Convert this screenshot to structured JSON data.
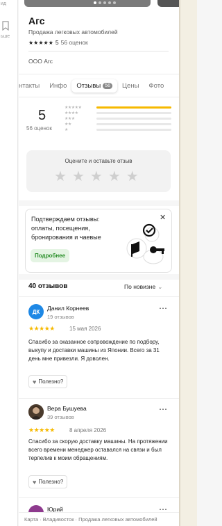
{
  "rail": {
    "top_text": "ид",
    "bottom_text": "ьше",
    "icon": "bookmark-icon"
  },
  "org": {
    "title": "Агс",
    "category": "Продажа легковых автомобилей",
    "rating_value": "5",
    "reviews_count_label": "56 оценок",
    "legal_name": "ООО Агс"
  },
  "tabs": [
    {
      "label": "нтакты"
    },
    {
      "label": "Инфо"
    },
    {
      "label": "Отзывы",
      "badge": "56"
    },
    {
      "label": "Цены"
    },
    {
      "label": "Фото"
    }
  ],
  "summary": {
    "rating": "5",
    "count_label": "56 оценок",
    "distribution": [
      {
        "stars": "★★★★★",
        "fraction": 1.0
      },
      {
        "stars": "★★★★",
        "fraction": 0
      },
      {
        "stars": "★★★",
        "fraction": 0
      },
      {
        "stars": "★★",
        "fraction": 0
      },
      {
        "stars": "★",
        "fraction": 0
      }
    ]
  },
  "rate_prompt": {
    "label": "Оцените и оставьте отзыв"
  },
  "promo": {
    "text": "Подтверждаем отзывы: оплаты, посещения, бронирования и чаевые",
    "button_label": "Подробнее",
    "close_icon": "close-icon"
  },
  "reviews_header": {
    "title": "40 отзывов",
    "sort_label": "По новизне"
  },
  "reviews": [
    {
      "initials": "ДК",
      "name": "Данил Корнеев",
      "sub": "19 отзывов",
      "stars": "★★★★★",
      "date": "15 мая 2026",
      "text": "Спасибо за оказанное сопровождение по подбору, выкупу и доставки машины из Японии. Всего за 31 день мне привезли. Я доволен.",
      "useful_label": "Полезно?",
      "avatar_color": "#1e88e5"
    },
    {
      "initials": "",
      "name": "Вера Бушуева",
      "sub": "39 отзывов",
      "stars": "★★★★★",
      "date": "8 апреля 2026",
      "text": "Спасибо за скорую доставку машины. На протяжении всего времени менеджер оставался на связи и был терпелив к моим обращениям.",
      "useful_label": "Полезно?",
      "avatar_color": "#5a4636"
    },
    {
      "initials": "",
      "name": "Юрий",
      "sub": "",
      "avatar_color": "#8e3a8e"
    }
  ],
  "footer": {
    "text": "Карта · Владивосток · Продажа легковых автомобилей"
  }
}
